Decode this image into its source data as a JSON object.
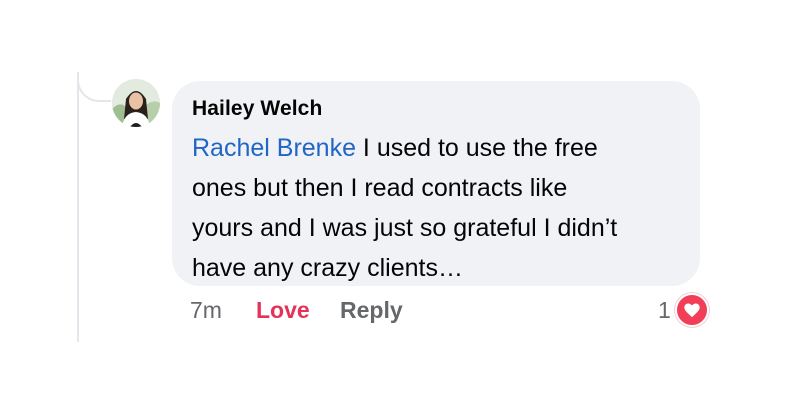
{
  "comment": {
    "author": "Hailey Welch",
    "mention": "Rachel Brenke",
    "lines": [
      " I used to use the free",
      "ones but then I read contracts like",
      "yours and I was just so grateful I didn’t",
      "have any crazy clients…"
    ],
    "avatar_icon": "profile-photo"
  },
  "actions": {
    "time": "7m",
    "love_label": "Love",
    "reply_label": "Reply"
  },
  "reactions": {
    "count": "1",
    "icon": "heart-icon",
    "color": "#f33e58"
  },
  "colors": {
    "mention": "#2165c6",
    "love": "#e4325a",
    "bubble": "#f0f2f5"
  }
}
